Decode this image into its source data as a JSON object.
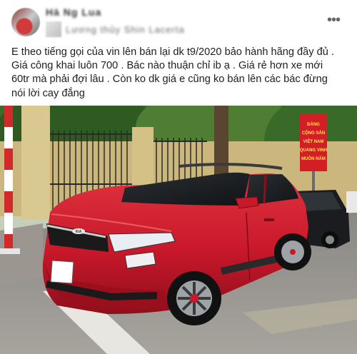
{
  "post": {
    "author_name": "Hà Ng Lua",
    "meta_text": "Lương thủy Shin Lacerta",
    "more_icon": "more-horizontal-icon",
    "body_lines": [
      "E theo tiếng gọi của vin lên bán lại dk t9/2020 bảo hành hãng đầy đủ .",
      "Giá công khai luôn 700 . Bác nào thuận chỉ ib ạ . Giá rẻ hơn xe mới",
      "60tr mà phải đợi lâu . Còn ko dk giá e cũng ko bán lên các bác đừng",
      "nói lời cay đắng"
    ]
  },
  "photo": {
    "description_icon": "car-photo",
    "sign_lines": [
      "ĐẢNG",
      "CỘNG SẢN",
      "VIỆT NAM",
      "QUANG VINH",
      "MUÔN NĂM"
    ],
    "car_brand": "KIA"
  },
  "colors": {
    "car_red": "#c8182a",
    "sign_red": "#d21f26",
    "text": "#1c1e21",
    "meta": "#65676b"
  }
}
